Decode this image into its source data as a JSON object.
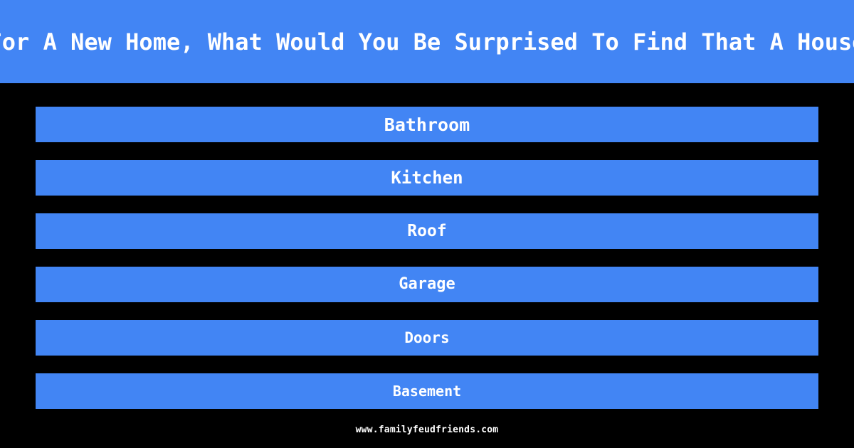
{
  "card": {
    "background_color": "#000000",
    "accent_color": "#4285f4",
    "text_color": "#ffffff"
  },
  "header": {
    "question": "When Looking For A New Home, What Would You Be Surprised To Find That A House Didn't Have?",
    "visible_question_fragment": "ooking For A New Home, What Would You Be Surprised To Find That A House Didn",
    "background_color": "#4285f4"
  },
  "answers": [
    {
      "rank": 1,
      "label": "Bathroom"
    },
    {
      "rank": 2,
      "label": "Kitchen"
    },
    {
      "rank": 3,
      "label": "Roof"
    },
    {
      "rank": 4,
      "label": "Garage"
    },
    {
      "rank": 5,
      "label": "Doors"
    },
    {
      "rank": 6,
      "label": "Basement"
    }
  ],
  "footer": {
    "url": "www.familyfeudfriends.com"
  }
}
